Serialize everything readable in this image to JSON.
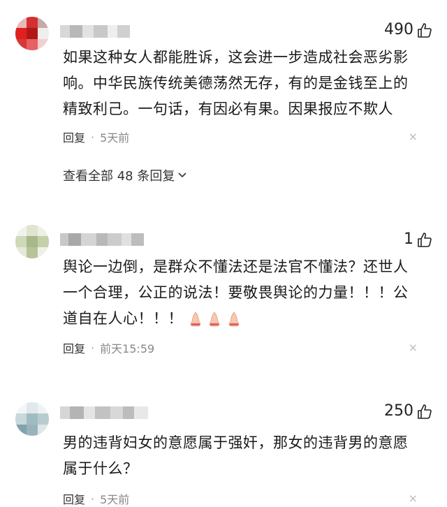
{
  "comments": [
    {
      "likes": "490",
      "text": "如果这种女人都能胜诉，这会进一步造成社会恶劣影响。中华民族传统美德荡然无存，有的是金钱至上的精致利己。一句话，有因必有果。因果报应不欺人",
      "reply_label": "回复",
      "dot": "·",
      "time": "5天前",
      "replies_link": "查看全部 48 条回复",
      "close": "×"
    },
    {
      "likes": "1",
      "text": "舆论一边倒，是群众不懂法还是法官不懂法？还世人一个合理，公正的说法！要敬畏舆论的力量！！！公道自在人心！！！",
      "reply_label": "回复",
      "dot": "·",
      "time": "前天15:59",
      "close": "×",
      "emoji_count": 3
    },
    {
      "likes": "250",
      "text": "男的违背妇女的意愿属于强奸，那女的违背男的意愿属于什么？",
      "reply_label": "回复",
      "dot": "·",
      "time": "5天前",
      "close": "×"
    }
  ],
  "icons": {
    "like": "thumbs-up-outline-icon",
    "expand": "chevron-down-icon",
    "close": "close-icon",
    "emoji": "praying-hands-emoji"
  },
  "colors": {
    "text": "#1a1a1a",
    "meta_time": "#888888",
    "close": "#bbbbbb"
  }
}
